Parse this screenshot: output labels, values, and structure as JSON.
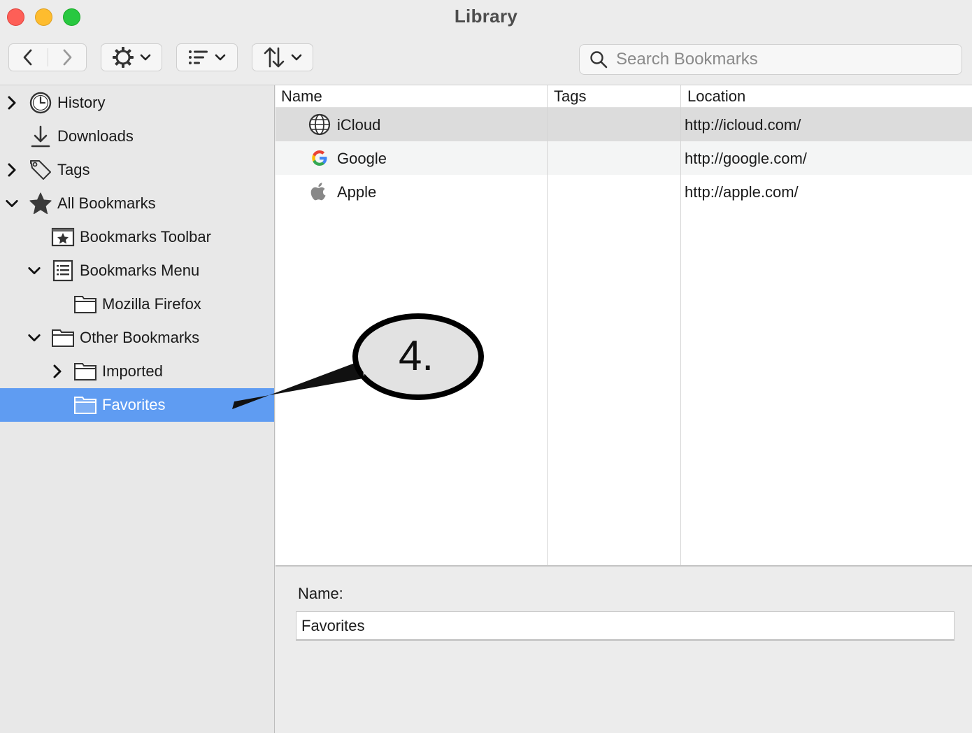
{
  "window": {
    "title": "Library"
  },
  "toolbar": {
    "search": {
      "placeholder": "Search Bookmarks",
      "value": ""
    }
  },
  "sidebar": {
    "items": [
      {
        "label": "History",
        "icon": "clock-icon",
        "expandable": true,
        "expanded": false
      },
      {
        "label": "Downloads",
        "icon": "download-icon",
        "expandable": false
      },
      {
        "label": "Tags",
        "icon": "tag-icon",
        "expandable": true,
        "expanded": false
      },
      {
        "label": "All Bookmarks",
        "icon": "star-icon",
        "expandable": true,
        "expanded": true
      },
      {
        "label": "Bookmarks Toolbar",
        "icon": "toolbar-star-icon",
        "expandable": false
      },
      {
        "label": "Bookmarks Menu",
        "icon": "menu-list-icon",
        "expandable": true,
        "expanded": true
      },
      {
        "label": "Mozilla Firefox",
        "icon": "folder-icon",
        "expandable": false
      },
      {
        "label": "Other Bookmarks",
        "icon": "folder-icon",
        "expandable": true,
        "expanded": true
      },
      {
        "label": "Imported",
        "icon": "folder-icon",
        "expandable": true,
        "expanded": false
      },
      {
        "label": "Favorites",
        "icon": "folder-icon",
        "expandable": false,
        "selected": true
      }
    ]
  },
  "table": {
    "columns": [
      "Name",
      "Tags",
      "Location"
    ],
    "rows": [
      {
        "name": "iCloud",
        "tags": "",
        "location": "http://icloud.com/",
        "icon": "globe-icon"
      },
      {
        "name": "Google",
        "tags": "",
        "location": "http://google.com/",
        "icon": "google-icon"
      },
      {
        "name": "Apple",
        "tags": "",
        "location": "http://apple.com/",
        "icon": "apple-icon"
      }
    ]
  },
  "details": {
    "name_label": "Name:",
    "name_value": "Favorites"
  },
  "annotation": {
    "label": "4."
  },
  "colors": {
    "selection": "#5f9cf2",
    "traffic_close": "#fe5f57",
    "traffic_minimize": "#febc2e",
    "traffic_maximize": "#28c840"
  }
}
